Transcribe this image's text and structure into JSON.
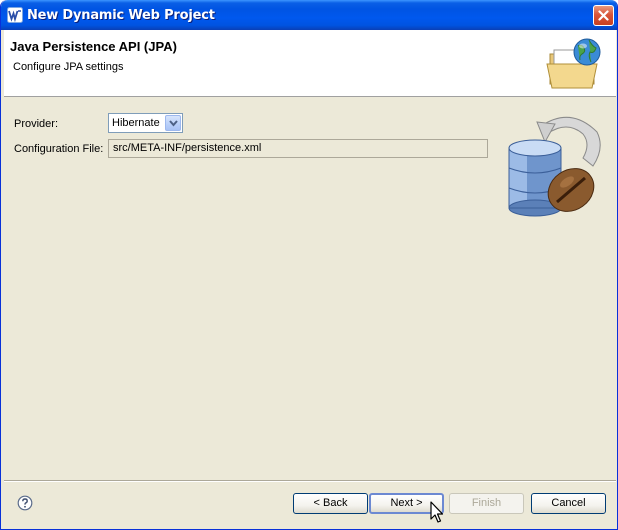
{
  "window": {
    "title": "New Dynamic Web Project"
  },
  "banner": {
    "title": "Java Persistence API (JPA)",
    "subtitle": "Configure JPA settings"
  },
  "form": {
    "provider_label": "Provider:",
    "provider_value": "Hibernate",
    "config_label": "Configuration File:",
    "config_value": "src/META-INF/persistence.xml"
  },
  "buttons": {
    "back": "< Back",
    "next": "Next >",
    "finish": "Finish",
    "cancel": "Cancel"
  },
  "icons": {
    "app": "eclipse-wtp-icon",
    "close": "close-icon",
    "banner": "folder-globe-icon",
    "jpa": "database-coffee-bean-icon",
    "help": "help-icon",
    "cursor": "mouse-pointer-icon"
  },
  "colors": {
    "titlebar": "#0054e3",
    "dialog_bg": "#ece9d8",
    "close_button": "#d9553a"
  }
}
